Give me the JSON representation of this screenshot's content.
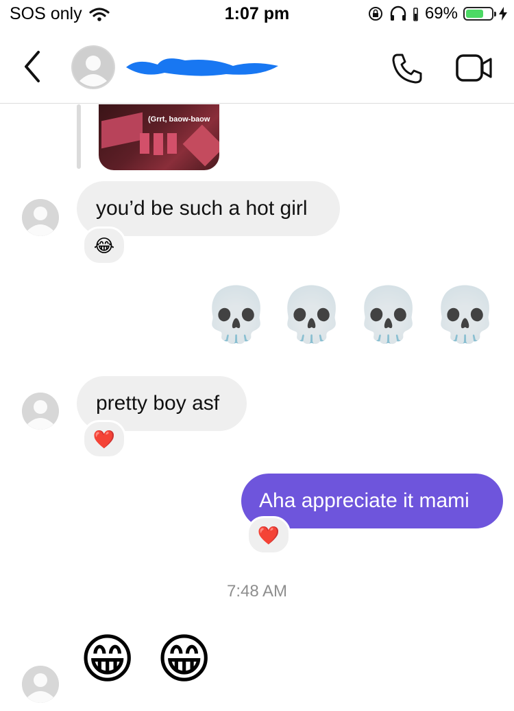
{
  "status_bar": {
    "carrier": "SOS only",
    "time": "1:07 pm",
    "battery": "69%",
    "battery_level": 0.69
  },
  "header": {
    "back_icon": "chevron-left-icon",
    "call_icon": "phone-icon",
    "video_icon": "video-camera-icon"
  },
  "thread": {
    "shared_media_caption": "(Grrt, baow-baow",
    "messages": [
      {
        "id": "m1",
        "direction": "incoming",
        "text": "you’d be such a hot girl",
        "reaction": "😂"
      },
      {
        "id": "m2",
        "direction": "outgoing",
        "emojis": [
          "💀",
          "💀",
          "💀",
          "💀"
        ]
      },
      {
        "id": "m3",
        "direction": "incoming",
        "text": "pretty boy asf",
        "reaction": "❤️"
      },
      {
        "id": "m4",
        "direction": "outgoing",
        "text": "Aha appreciate it mami",
        "reaction": "❤️"
      },
      {
        "id": "m5",
        "direction": "incoming",
        "emojis": [
          "😁",
          "😁"
        ]
      }
    ],
    "timestamp": "7:48 AM"
  },
  "colors": {
    "outgoing_bubble": "#6e55dc",
    "incoming_bubble": "#efefef",
    "timestamp_text": "#8e8e8e",
    "battery_fill": "#4cd964"
  }
}
